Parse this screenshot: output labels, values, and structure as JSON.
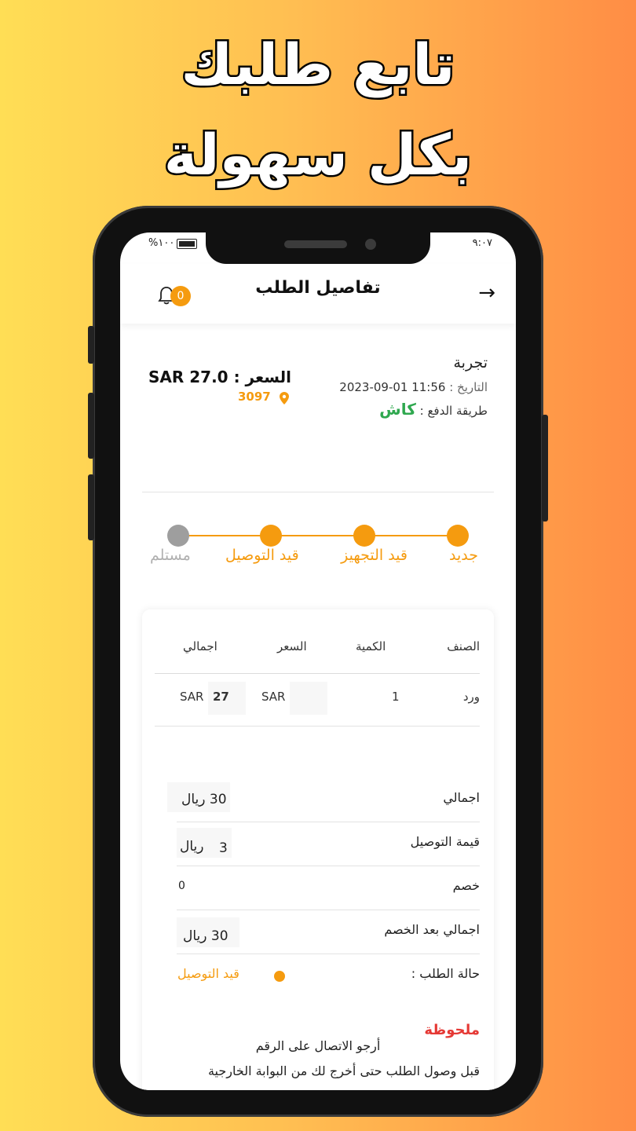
{
  "headline": {
    "line1": "تابع طلبك",
    "line2": "بكل سهولة"
  },
  "status_bar": {
    "time": "٩:٠٧",
    "battery": "%١٠٠"
  },
  "app_bar": {
    "title": "تفاصيل الطلب",
    "notification_count": "0"
  },
  "order": {
    "name": "تجربة",
    "date_label": "التاريخ :",
    "date_value": "2023-09-01 11:56",
    "payment_label": "طريقة الدفع :",
    "payment_value": "كاش",
    "price_label": "السعر :",
    "price_value": "SAR 27.0",
    "location_code": "3097"
  },
  "progress": {
    "steps": [
      "جديد",
      "قيد التجهيز",
      "قيد التوصيل",
      "مستلم"
    ],
    "active_count": 3
  },
  "items_table": {
    "headers": [
      "الصنف",
      "الكمية",
      "السعر",
      "اجمالي"
    ],
    "rows": [
      {
        "item": "ورد",
        "qty": "1",
        "price": "SAR",
        "total_value": "27",
        "total_currency": "SAR"
      }
    ]
  },
  "summary": {
    "total_label": "اجمالي",
    "total_value": "30 ريال",
    "delivery_label": "قيمة التوصيل",
    "delivery_value": "3",
    "delivery_currency": "ريال",
    "discount_label": "خصم",
    "discount_value": "0",
    "after_discount_label": "اجمالي بعد الخصم",
    "after_discount_value": "30 ريال",
    "status_label": "حالة الطلب :",
    "status_value": "قيد التوصيل"
  },
  "note": {
    "title": "ملحوظة",
    "line1": "أرجو الاتصال على الرقم",
    "line2": "قبل وصول الطلب حتى أخرج لك من البوابة الخارجية"
  },
  "colors": {
    "accent": "#f59b0f",
    "cash_green": "#2fa84f",
    "note_red": "#e53935",
    "inactive": "#9e9e9e"
  }
}
